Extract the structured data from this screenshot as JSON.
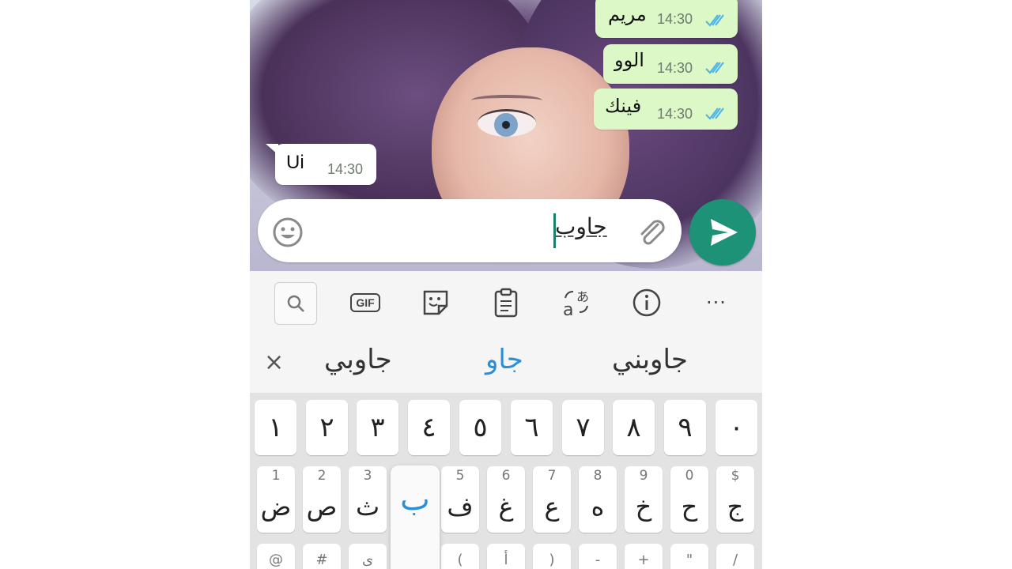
{
  "chat": {
    "outgoing": [
      {
        "text": "مريم",
        "time": "14:30"
      },
      {
        "text": "الوو",
        "time": "14:30"
      },
      {
        "text": "فينك",
        "time": "14:30"
      }
    ],
    "incoming": [
      {
        "text": "Ui",
        "time": "14:30"
      }
    ]
  },
  "composer": {
    "typed_text": "جاوب"
  },
  "keyboard_toolbar": {
    "items": [
      "search-icon",
      "gif-icon",
      "sticker-icon",
      "clipboard-icon",
      "translate-icon",
      "info-icon",
      "more-icon"
    ],
    "gif_label": "GIF",
    "more_label": "···"
  },
  "suggestions": {
    "left": "جاوبي",
    "center": "جاو",
    "right": "جاوبني",
    "close": "×"
  },
  "keyboard": {
    "number_row": [
      "١",
      "٢",
      "٣",
      "٤",
      "٥",
      "٦",
      "٧",
      "٨",
      "٩",
      "٠"
    ],
    "letter_row": [
      {
        "hint": "1",
        "char": "ض"
      },
      {
        "hint": "2",
        "char": "ص"
      },
      {
        "hint": "3",
        "char": "ث"
      },
      {
        "hint": "",
        "char": ""
      },
      {
        "hint": "5",
        "char": "ف"
      },
      {
        "hint": "6",
        "char": "غ"
      },
      {
        "hint": "7",
        "char": "ع"
      },
      {
        "hint": "8",
        "char": "ه"
      },
      {
        "hint": "9",
        "char": "خ"
      },
      {
        "hint": "0",
        "char": "ح"
      },
      {
        "hint": "$",
        "char": "ج"
      }
    ],
    "pressed_key": "ب",
    "bottom_row_hints": [
      "@",
      "#",
      "ى",
      "",
      "(",
      "أ",
      ")",
      "-",
      "+",
      "\"",
      "/"
    ]
  },
  "colors": {
    "outgoing_bubble": "#dcf8c6",
    "send_button": "#1e9276",
    "suggestion_highlight": "#2a8fd6",
    "read_ticks": "#4fb6ec"
  }
}
